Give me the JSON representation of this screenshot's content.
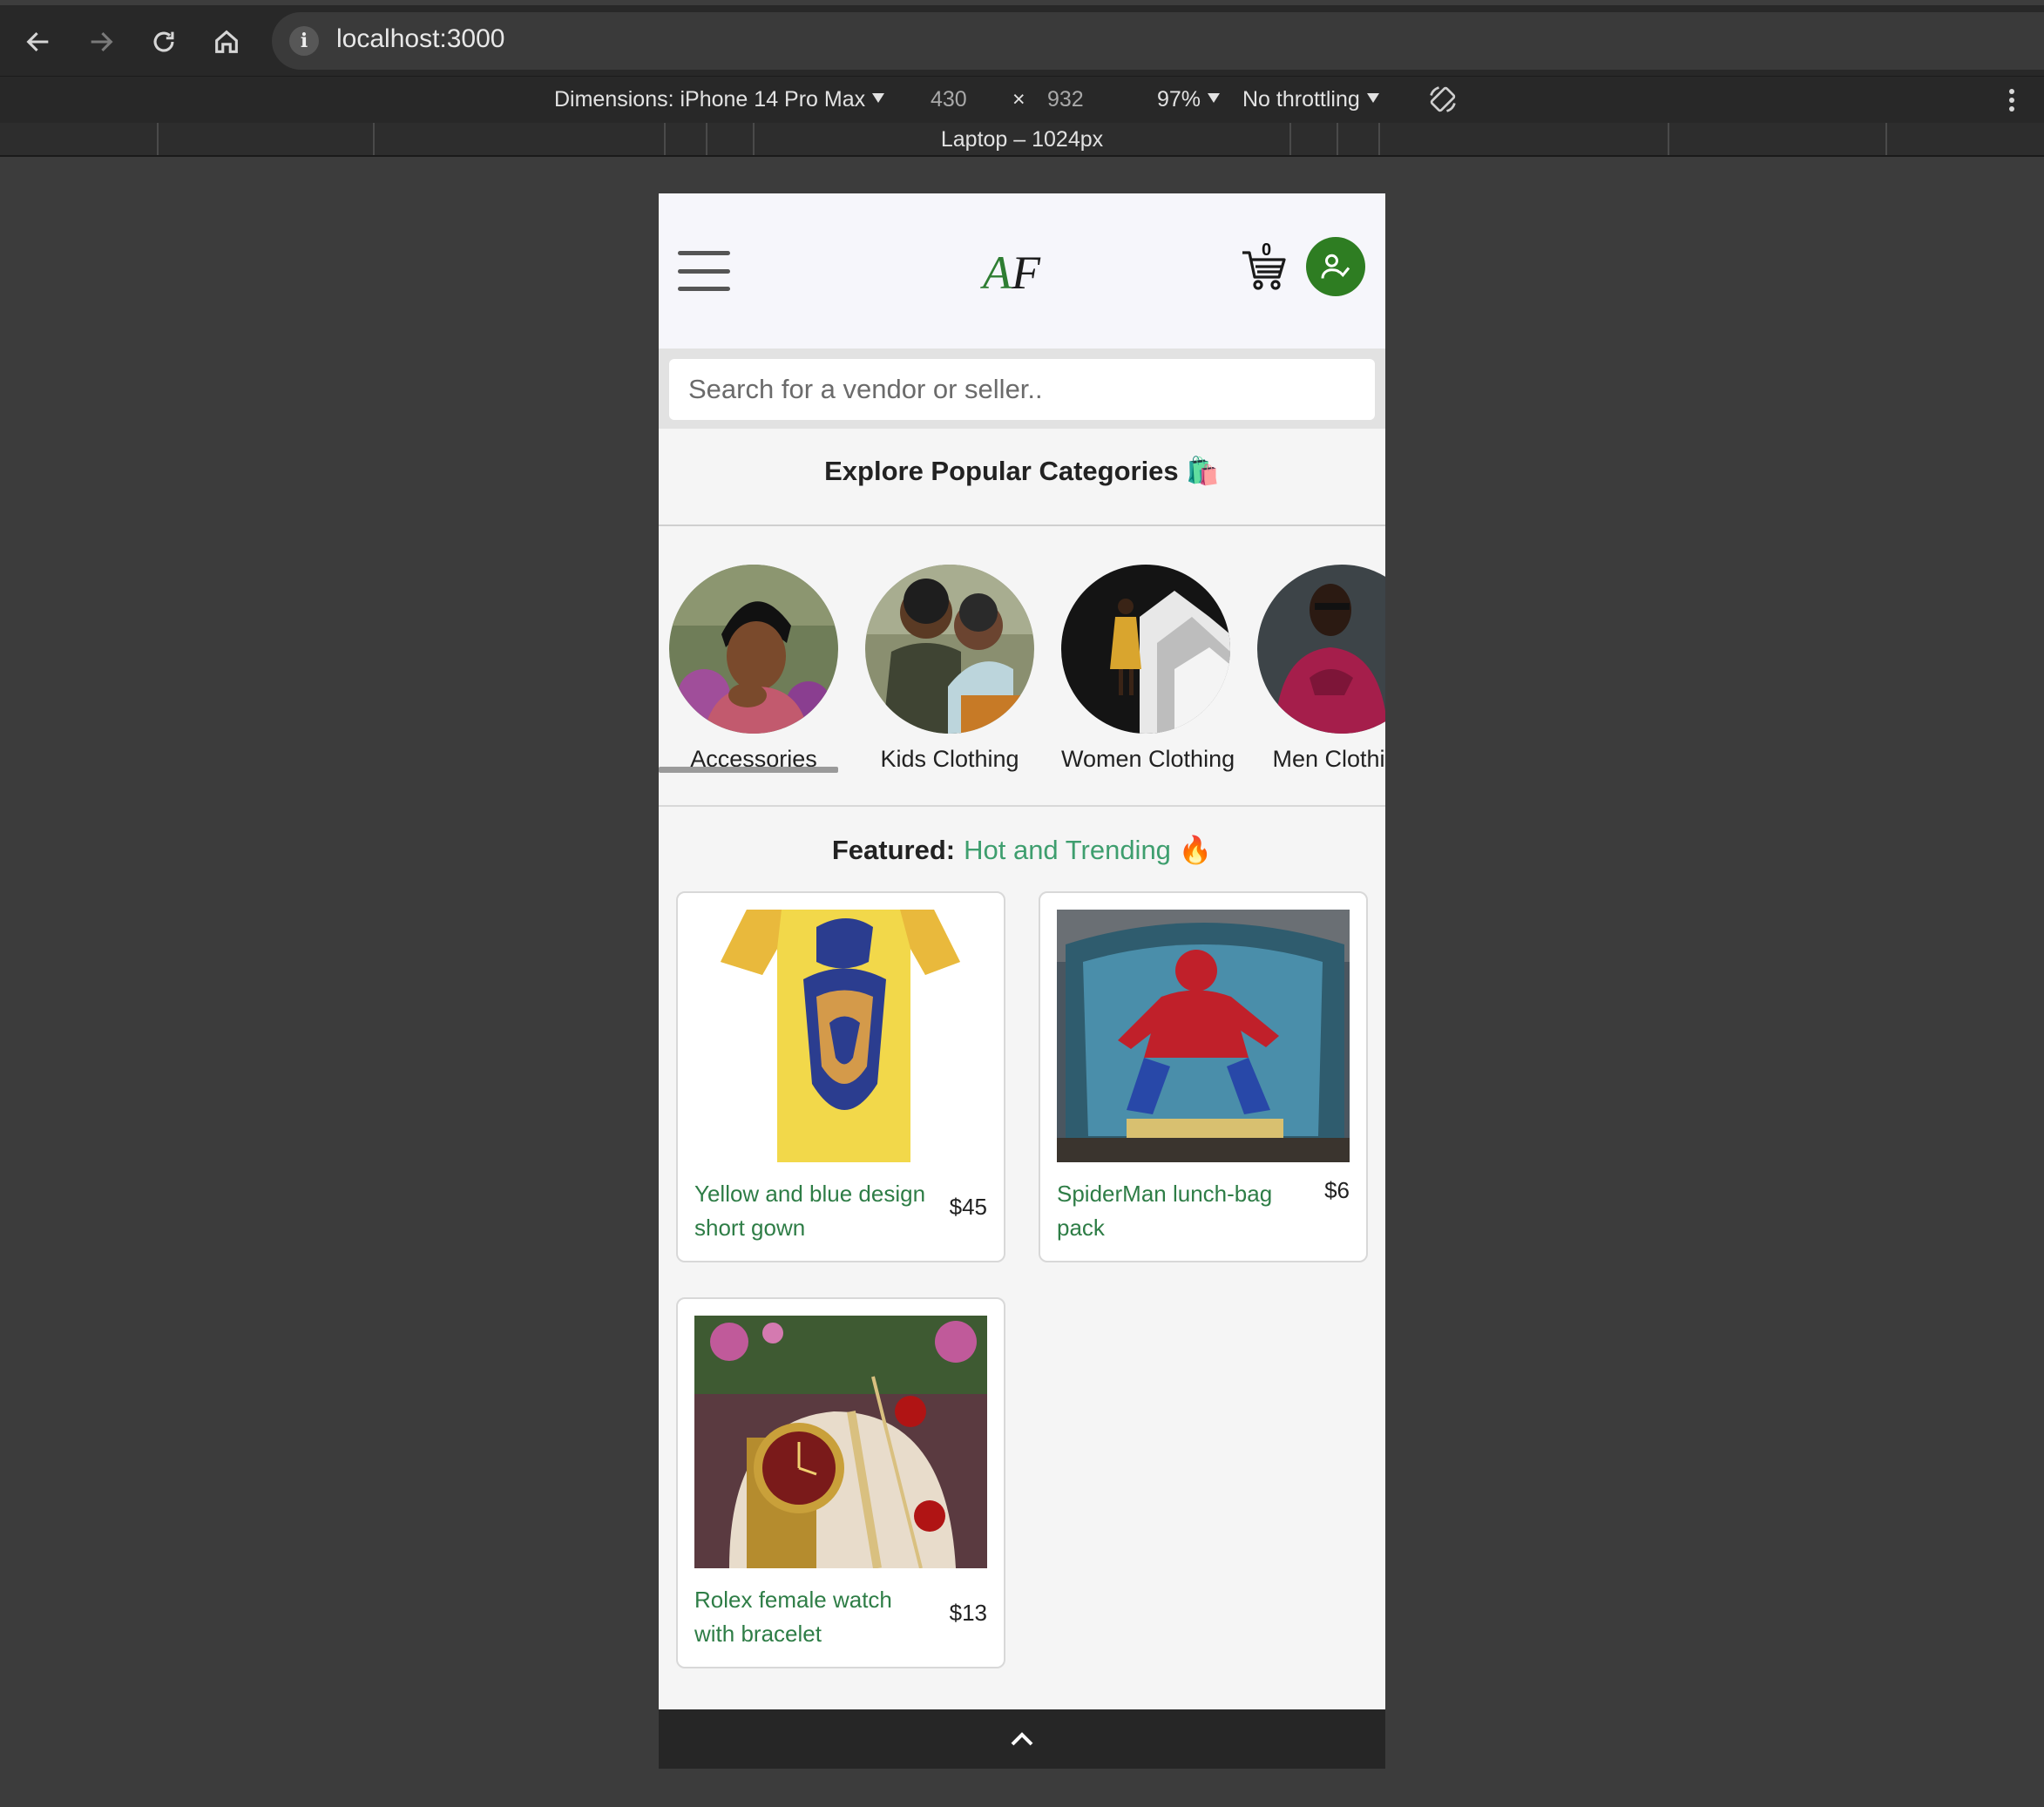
{
  "browser": {
    "url": "localhost:3000",
    "info_icon": "i"
  },
  "devtools": {
    "dimensions_label": "Dimensions: iPhone 14 Pro Max",
    "width": "430",
    "times": "×",
    "height": "932",
    "zoom": "97%",
    "throttling": "No throttling",
    "ruler_label": "Laptop – 1024px"
  },
  "header": {
    "logo_a": "A",
    "logo_f": "F",
    "cart_count": "0"
  },
  "search": {
    "placeholder": "Search for a vendor or seller.."
  },
  "explore": {
    "title": "Explore Popular Categories 🛍️"
  },
  "categories": [
    {
      "label": "Accessories"
    },
    {
      "label": "Kids Clothing"
    },
    {
      "label": "Women Clothing"
    },
    {
      "label": "Men Clothing"
    }
  ],
  "featured": {
    "label": "Featured:",
    "highlight": "Hot and Trending 🔥"
  },
  "products": [
    {
      "name": "Yellow and blue design short gown",
      "price": "$45"
    },
    {
      "name": "SpiderMan lunch-bag pack",
      "price": "$6"
    },
    {
      "name": "Rolex female watch with bracelet",
      "price": "$13"
    }
  ],
  "colors": {
    "brand_green": "#2e7d22",
    "link_green": "#2e7d46",
    "trending_green": "#3e9e6e"
  }
}
